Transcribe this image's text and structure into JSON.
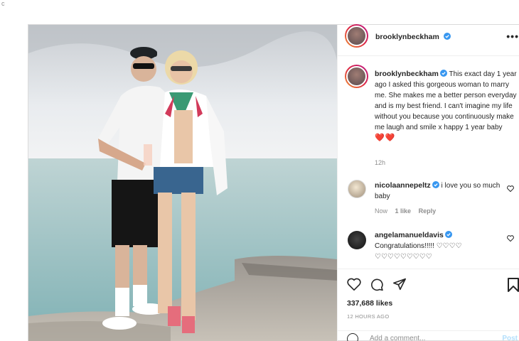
{
  "stray_mark": "c",
  "header": {
    "username": "brooklynbeckham",
    "more_label": "•••",
    "icons": {
      "verified": "verified-badge-icon",
      "more": "more-options-icon"
    }
  },
  "caption": {
    "username": "brooklynbeckham",
    "text": "This exact day 1 year ago I asked this gorgeous woman to marry me. She makes me a better person everyday and is my best friend. I can't imagine my life without you because you continuously make me laugh and smile x happy 1 year baby",
    "hearts": "❤️❤️",
    "time": "12h"
  },
  "comments": [
    {
      "username": "nicolaannepeltz",
      "text": "i love you so much baby",
      "time": "Now",
      "likes": "1 like",
      "reply": "Reply"
    },
    {
      "username": "angelamanueldavis",
      "text": "Congratulations!!!!! ♡♡♡♡ ♡♡♡♡♡♡♡♡♡"
    }
  ],
  "actions": {
    "likes": "337,688 likes",
    "ago": "12 HOURS AGO",
    "icons": [
      "heart-icon",
      "comment-icon",
      "share-icon",
      "bookmark-icon"
    ]
  },
  "add_comment": {
    "placeholder": "Add a comment...",
    "post_label": "Post"
  },
  "colors": {
    "verified": "#3897f0",
    "link_blue_disabled": "#b2dffc",
    "muted": "#8e8e8e",
    "heart_red": "#e0245e"
  }
}
